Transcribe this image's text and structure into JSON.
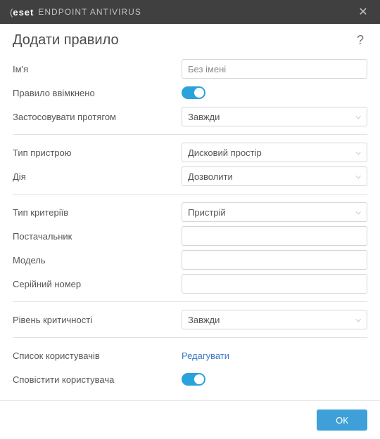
{
  "titlebar": {
    "brand": "eset",
    "product": "ENDPOINT ANTIVIRUS"
  },
  "header": {
    "title": "Додати правило"
  },
  "fields": {
    "name": {
      "label": "Ім'я",
      "placeholder": "Без імені",
      "value": ""
    },
    "enabled": {
      "label": "Правило ввімкнено",
      "value": true
    },
    "apply_during": {
      "label": "Застосовувати протягом",
      "selected": "Завжди"
    },
    "device_type": {
      "label": "Тип пристрою",
      "selected": "Дисковий простір"
    },
    "action": {
      "label": "Дія",
      "selected": "Дозволити"
    },
    "criteria_type": {
      "label": "Тип критеріїв",
      "selected": "Пристрій"
    },
    "vendor": {
      "label": "Постачальник",
      "value": ""
    },
    "model": {
      "label": "Модель",
      "value": ""
    },
    "serial": {
      "label": "Серійний номер",
      "value": ""
    },
    "severity": {
      "label": "Рівень критичності",
      "selected": "Завжди"
    },
    "user_list": {
      "label": "Список користувачів",
      "link": "Редагувати"
    },
    "notify_user": {
      "label": "Сповістити користувача",
      "value": true
    }
  },
  "footer": {
    "ok": "ОК"
  }
}
